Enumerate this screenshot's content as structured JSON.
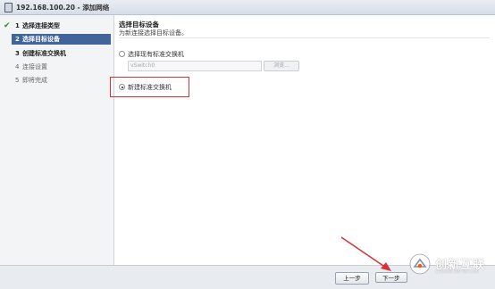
{
  "window": {
    "title": "192.168.100.20 - 添加网络"
  },
  "sidebar": {
    "steps": [
      {
        "num": "1",
        "label": "选择连接类型",
        "state": "done"
      },
      {
        "num": "2",
        "label": "选择目标设备",
        "state": "active"
      },
      {
        "num": "3",
        "label": "创建标准交换机",
        "state": "bold"
      },
      {
        "num": "4",
        "label": "连接设置",
        "state": "pending"
      },
      {
        "num": "5",
        "label": "即将完成",
        "state": "pending"
      }
    ],
    "check_glyph": "✔"
  },
  "main": {
    "heading": "选择目标设备",
    "subheading": "为新连接选择目标设备。",
    "options": [
      {
        "label": "选择现有标准交换机",
        "checked": false
      },
      {
        "label": "新建标准交换机",
        "checked": true
      }
    ],
    "switch_input_value": "vSwitch0",
    "browse_label": "浏览..."
  },
  "footer": {
    "back_label": "上一步",
    "next_label": "下一步"
  },
  "watermark": {
    "text": "创新互联",
    "subtext": "CHUANG XIN HU LIAN"
  },
  "colors": {
    "active_step": "#41659a",
    "check": "#2f8a2f",
    "highlight": "#d93232"
  }
}
